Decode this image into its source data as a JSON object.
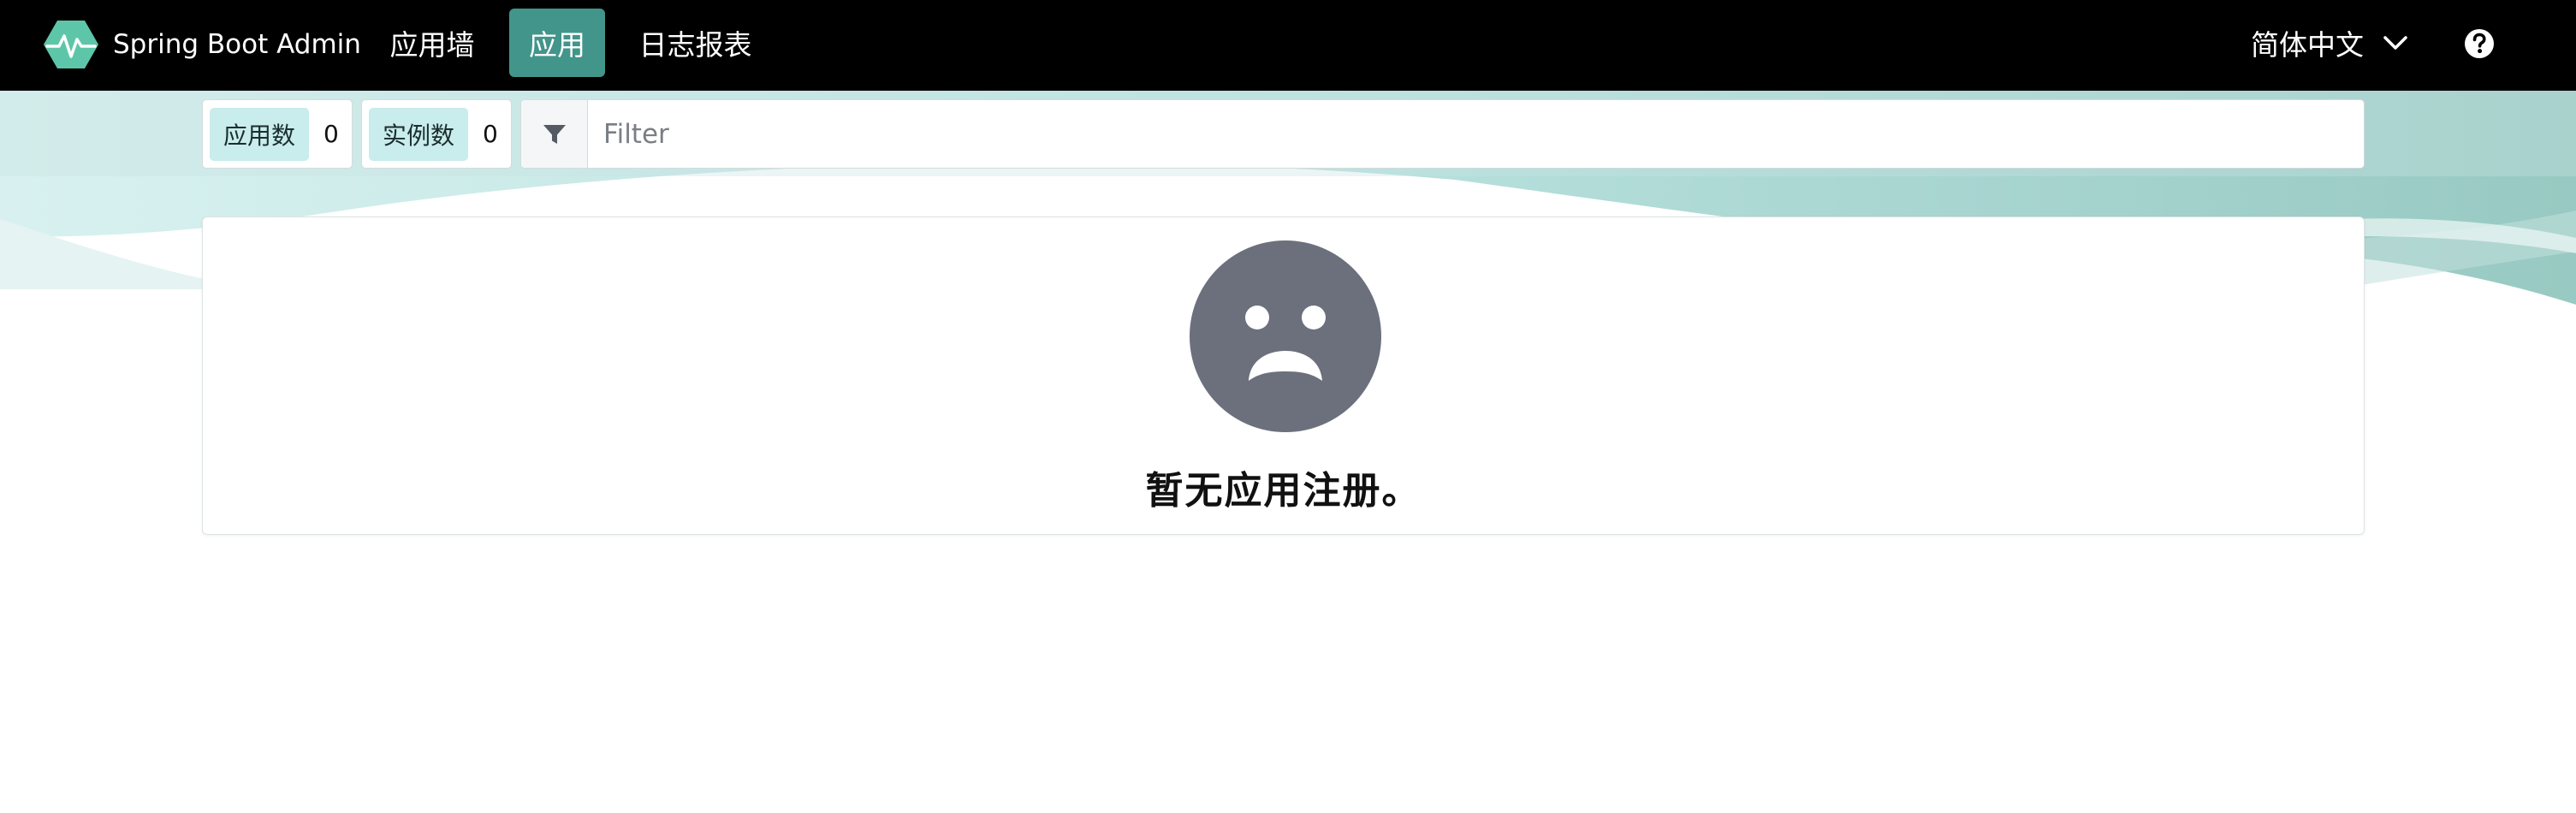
{
  "navbar": {
    "brand": "Spring Boot Admin",
    "logo_icon": "heartbeat-hexagon-icon",
    "items": [
      {
        "label": "应用墙",
        "active": false
      },
      {
        "label": "应用",
        "active": true
      },
      {
        "label": "日志报表",
        "active": false
      }
    ],
    "language": "简体中文",
    "language_icon": "chevron-down-icon",
    "help_icon": "question-circle-icon"
  },
  "stats": {
    "applications": {
      "label": "应用数",
      "value": "0"
    },
    "instances": {
      "label": "实例数",
      "value": "0"
    }
  },
  "filter": {
    "icon": "filter-icon",
    "placeholder": "Filter",
    "value": ""
  },
  "empty_state": {
    "icon": "sad-face-icon",
    "message": "暂无应用注册。"
  },
  "colors": {
    "navbar_bg": "#000000",
    "active_nav": "#42958a",
    "brand_green": "#5ec6a8",
    "stat_label_bg": "#c9ecec",
    "sad_face": "#6c707d"
  }
}
